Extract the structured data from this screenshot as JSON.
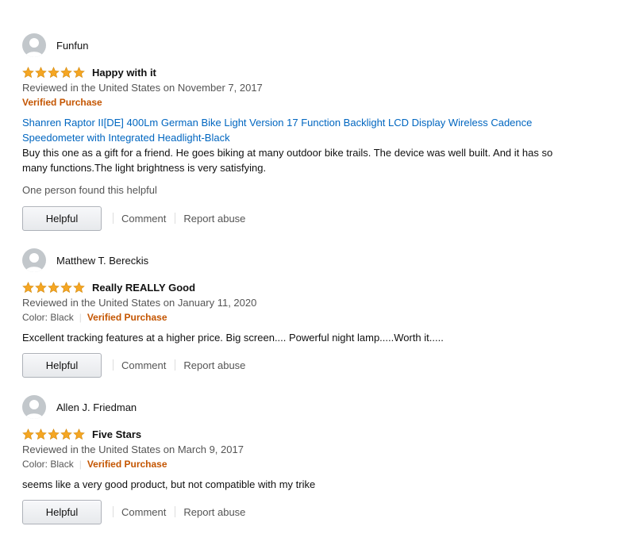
{
  "colors": {
    "verified": "#c45500",
    "link": "#0066c0",
    "star": "#f5a623",
    "avatar_bg": "#c2c7cb"
  },
  "icons": {
    "avatar": "person-silhouette-icon",
    "star": "star-filled-icon"
  },
  "reviews": [
    {
      "reviewer": "Funfun",
      "rating": 5,
      "title": "Happy with it",
      "date": "Reviewed in the United States on November 7, 2017",
      "verified": "Verified Purchase",
      "product_link": "Shanren Raptor II[DE] 400Lm German Bike Light Version 17 Function Backlight LCD Display Wireless Cadence Speedometer with Integrated Headlight-Black",
      "body": "Buy this one as a gift for a friend. He goes biking at many outdoor bike trails. The device was well built. And it has so many functions.The light brightness is very satisfying.",
      "helpful_count": "One person found this helpful",
      "helpful_label": "Helpful",
      "comment_label": "Comment",
      "report_label": "Report abuse"
    },
    {
      "reviewer": "Matthew T. Bereckis",
      "rating": 5,
      "title": "Really REALLY Good",
      "date": "Reviewed in the United States on January 11, 2020",
      "color": "Color: Black",
      "verified": "Verified Purchase",
      "body": "Excellent tracking features at a higher price. Big screen.... Powerful night lamp.....Worth it.....",
      "helpful_label": "Helpful",
      "comment_label": "Comment",
      "report_label": "Report abuse"
    },
    {
      "reviewer": "Allen J. Friedman",
      "rating": 5,
      "title": "Five Stars",
      "date": "Reviewed in the United States on March 9, 2017",
      "color": "Color: Black",
      "verified": "Verified Purchase",
      "body": "seems like a very good product, but not compatible with my trike",
      "helpful_label": "Helpful",
      "comment_label": "Comment",
      "report_label": "Report abuse"
    }
  ]
}
